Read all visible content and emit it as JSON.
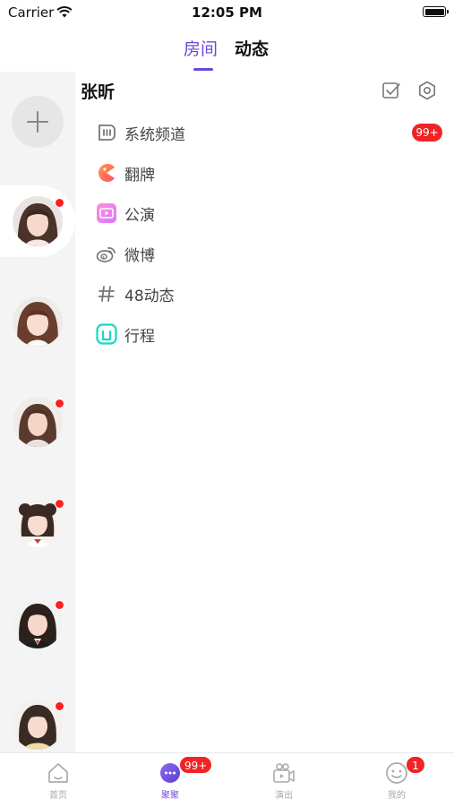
{
  "status_bar": {
    "carrier": "Carrier",
    "time": "12:05 PM"
  },
  "tabs": [
    {
      "label": "房间",
      "active": true
    },
    {
      "label": "动态",
      "active": false
    }
  ],
  "channel": {
    "name": "张昕",
    "menu": [
      {
        "label": "系统频道",
        "icon": "channel-icon",
        "badge": "99+"
      },
      {
        "label": "翻牌",
        "icon": "flip-card-icon"
      },
      {
        "label": "公演",
        "icon": "performance-icon"
      },
      {
        "label": "微博",
        "icon": "weibo-icon"
      },
      {
        "label": "48动态",
        "icon": "hashtag-icon"
      },
      {
        "label": "行程",
        "icon": "schedule-icon"
      }
    ]
  },
  "rail": {
    "avatars": [
      {
        "name": "avatar-1",
        "unread": true,
        "selected": true
      },
      {
        "name": "avatar-2",
        "unread": false
      },
      {
        "name": "avatar-3",
        "unread": true
      },
      {
        "name": "avatar-4",
        "unread": true
      },
      {
        "name": "avatar-5",
        "unread": true
      },
      {
        "name": "avatar-6",
        "unread": true
      }
    ]
  },
  "bottom_nav": [
    {
      "label": "首页",
      "icon": "home-icon",
      "badge": ""
    },
    {
      "label": "聚聚",
      "icon": "chat-icon",
      "badge": "99+",
      "active": true
    },
    {
      "label": "演出",
      "icon": "video-icon",
      "badge": ""
    },
    {
      "label": "我的",
      "icon": "profile-icon",
      "badge": "1"
    }
  ],
  "colors": {
    "accent": "#6b48d6",
    "badge": "#f12324",
    "rail_bg": "#f4f4f4"
  }
}
